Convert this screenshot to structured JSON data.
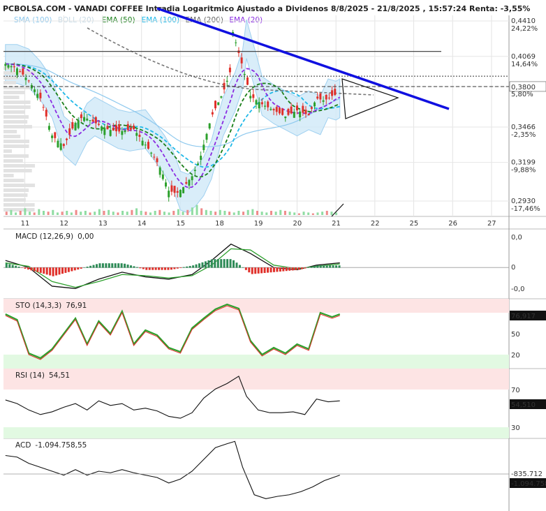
{
  "chart_data": [
    {
      "type": "candlestick",
      "title": "PCBOLSA.COM - VANADI COFFEE Intradia Logaritmico Ajustado a Dividenos 8/8/2025 - 21/8/2025 , 15:57:24 Renta: -3,55%",
      "legend": [
        {
          "label": "SMA (100)",
          "color": "#8ec9ee"
        },
        {
          "label": "BOLL (20)",
          "color": "#c8dbe6"
        },
        {
          "label": "EMA (50)",
          "color": "#1a7f1a"
        },
        {
          "label": "EMA (100)",
          "color": "#1fb8e8"
        },
        {
          "label": "EMA (200)",
          "color": "#666666"
        },
        {
          "label": "EMA (20)",
          "color": "#8a2be2"
        }
      ],
      "x_tick_labels": [
        "11",
        "12",
        "13",
        "14",
        "15",
        "18",
        "19",
        "20",
        "21",
        "22",
        "25",
        "26",
        "27"
      ],
      "y_tick_labels": [
        "0,4410",
        "0,4069",
        "0,3800",
        "0,3466",
        "0,3199",
        "0,2930"
      ],
      "y_pct_labels": [
        "24,22%",
        "14,64%",
        "5,80%",
        "-2,35%",
        "-9,88%",
        "-17,46%"
      ],
      "last_price": "0,3800",
      "ylim": [
        0.293,
        0.441
      ],
      "y_scale": "log",
      "close_path": [
        [
          0.0,
          0.4
        ],
        [
          0.3,
          0.396
        ],
        [
          0.6,
          0.385
        ],
        [
          0.9,
          0.37
        ],
        [
          1.2,
          0.34
        ],
        [
          1.5,
          0.332
        ],
        [
          1.8,
          0.35
        ],
        [
          2.0,
          0.355
        ],
        [
          2.3,
          0.35
        ],
        [
          2.6,
          0.345
        ],
        [
          2.9,
          0.343
        ],
        [
          3.3,
          0.345
        ],
        [
          3.6,
          0.333
        ],
        [
          3.8,
          0.325
        ],
        [
          4.0,
          0.315
        ],
        [
          4.2,
          0.3
        ],
        [
          4.4,
          0.298
        ],
        [
          4.6,
          0.303
        ],
        [
          4.8,
          0.31
        ],
        [
          5.0,
          0.322
        ],
        [
          5.3,
          0.355
        ],
        [
          5.6,
          0.375
        ],
        [
          5.8,
          0.395
        ],
        [
          5.85,
          0.43
        ],
        [
          6.0,
          0.41
        ],
        [
          6.3,
          0.372
        ],
        [
          6.6,
          0.365
        ],
        [
          6.9,
          0.36
        ],
        [
          7.2,
          0.355
        ],
        [
          7.5,
          0.36
        ],
        [
          7.8,
          0.356
        ],
        [
          8.0,
          0.37
        ],
        [
          8.2,
          0.368
        ],
        [
          8.4,
          0.372
        ],
        [
          8.6,
          0.374
        ]
      ],
      "volume": [
        4,
        6,
        3,
        5,
        8,
        4,
        3,
        7,
        5,
        4,
        6,
        3,
        4,
        5,
        3,
        6,
        4,
        5,
        3,
        4,
        7,
        5,
        6,
        4,
        3,
        5,
        4,
        6,
        8,
        5,
        4,
        3,
        5,
        6,
        4,
        3,
        5,
        7,
        4,
        6,
        9,
        12,
        8,
        6,
        5,
        4,
        6,
        5,
        4,
        3,
        5,
        4,
        6,
        7,
        5,
        4,
        3,
        5,
        4,
        6,
        5,
        4,
        3,
        2,
        4,
        3,
        2,
        3,
        4,
        5,
        4,
        3
      ]
    },
    {
      "type": "line",
      "name": "MACD",
      "label": "MACD (12,26,9)",
      "value": "0,00",
      "y_tick_labels": [
        "0,0",
        "0",
        "-0,0"
      ],
      "macd": [
        [
          0.0,
          0.3
        ],
        [
          0.6,
          0.0
        ],
        [
          1.2,
          -0.8
        ],
        [
          1.8,
          -0.9
        ],
        [
          2.4,
          -0.5
        ],
        [
          3.0,
          -0.2
        ],
        [
          3.6,
          -0.4
        ],
        [
          4.2,
          -0.5
        ],
        [
          4.8,
          -0.3
        ],
        [
          5.3,
          0.3
        ],
        [
          5.8,
          1.0
        ],
        [
          6.3,
          0.6
        ],
        [
          6.9,
          0.0
        ],
        [
          7.5,
          -0.1
        ],
        [
          8.0,
          0.1
        ],
        [
          8.6,
          0.2
        ]
      ],
      "signal": [
        [
          0.0,
          0.2
        ],
        [
          0.6,
          0.05
        ],
        [
          1.2,
          -0.6
        ],
        [
          1.8,
          -0.85
        ],
        [
          2.4,
          -0.6
        ],
        [
          3.0,
          -0.3
        ],
        [
          3.6,
          -0.35
        ],
        [
          4.2,
          -0.45
        ],
        [
          4.8,
          -0.35
        ],
        [
          5.3,
          0.1
        ],
        [
          5.8,
          0.8
        ],
        [
          6.3,
          0.75
        ],
        [
          6.9,
          0.1
        ],
        [
          7.5,
          -0.05
        ],
        [
          8.0,
          0.05
        ],
        [
          8.6,
          0.15
        ]
      ]
    },
    {
      "type": "line",
      "name": "STO",
      "label": "STO (14,3,3)",
      "value": "76,91",
      "last_value": "76,917",
      "y_tick_labels": [
        "50",
        "20"
      ],
      "bands": [
        80,
        20
      ],
      "values": [
        [
          0.0,
          78
        ],
        [
          0.3,
          70
        ],
        [
          0.6,
          22
        ],
        [
          0.9,
          15
        ],
        [
          1.2,
          28
        ],
        [
          1.5,
          50
        ],
        [
          1.8,
          72
        ],
        [
          2.1,
          35
        ],
        [
          2.4,
          68
        ],
        [
          2.7,
          50
        ],
        [
          3.0,
          82
        ],
        [
          3.3,
          35
        ],
        [
          3.6,
          55
        ],
        [
          3.9,
          48
        ],
        [
          4.2,
          30
        ],
        [
          4.5,
          24
        ],
        [
          4.8,
          58
        ],
        [
          5.1,
          72
        ],
        [
          5.4,
          85
        ],
        [
          5.7,
          92
        ],
        [
          6.0,
          86
        ],
        [
          6.3,
          40
        ],
        [
          6.6,
          20
        ],
        [
          6.9,
          30
        ],
        [
          7.2,
          22
        ],
        [
          7.5,
          35
        ],
        [
          7.8,
          28
        ],
        [
          8.1,
          80
        ],
        [
          8.4,
          74
        ],
        [
          8.6,
          78
        ]
      ]
    },
    {
      "type": "line",
      "name": "RSI",
      "label": "RSI (14)",
      "value": "54,51",
      "last_value": "54,510",
      "y_tick_labels": [
        "70",
        "30"
      ],
      "bands": [
        70,
        30
      ],
      "values": [
        [
          0.0,
          56
        ],
        [
          0.3,
          52
        ],
        [
          0.6,
          45
        ],
        [
          0.9,
          40
        ],
        [
          1.2,
          43
        ],
        [
          1.5,
          48
        ],
        [
          1.8,
          52
        ],
        [
          2.1,
          45
        ],
        [
          2.4,
          55
        ],
        [
          2.7,
          50
        ],
        [
          3.0,
          52
        ],
        [
          3.3,
          45
        ],
        [
          3.6,
          47
        ],
        [
          3.9,
          44
        ],
        [
          4.2,
          38
        ],
        [
          4.5,
          36
        ],
        [
          4.8,
          42
        ],
        [
          5.1,
          58
        ],
        [
          5.4,
          68
        ],
        [
          5.7,
          74
        ],
        [
          6.0,
          82
        ],
        [
          6.2,
          60
        ],
        [
          6.5,
          45
        ],
        [
          6.8,
          42
        ],
        [
          7.1,
          42
        ],
        [
          7.4,
          43
        ],
        [
          7.7,
          40
        ],
        [
          8.0,
          57
        ],
        [
          8.3,
          54
        ],
        [
          8.6,
          55
        ]
      ]
    },
    {
      "type": "line",
      "name": "ACD",
      "label": "ACD",
      "value": "-1.094.758,55",
      "y_tick_labels": [
        "-835.712",
        "-1.094.758"
      ],
      "values": [
        [
          0.0,
          0.2
        ],
        [
          0.3,
          0.22
        ],
        [
          0.6,
          0.3
        ],
        [
          0.9,
          0.35
        ],
        [
          1.2,
          0.4
        ],
        [
          1.5,
          0.45
        ],
        [
          1.8,
          0.38
        ],
        [
          2.1,
          0.45
        ],
        [
          2.4,
          0.4
        ],
        [
          2.7,
          0.42
        ],
        [
          3.0,
          0.38
        ],
        [
          3.3,
          0.42
        ],
        [
          3.6,
          0.45
        ],
        [
          3.9,
          0.48
        ],
        [
          4.2,
          0.55
        ],
        [
          4.5,
          0.5
        ],
        [
          4.8,
          0.4
        ],
        [
          5.1,
          0.25
        ],
        [
          5.4,
          0.1
        ],
        [
          5.7,
          0.05
        ],
        [
          5.9,
          0.02
        ],
        [
          6.1,
          0.35
        ],
        [
          6.4,
          0.7
        ],
        [
          6.7,
          0.75
        ],
        [
          7.0,
          0.72
        ],
        [
          7.3,
          0.7
        ],
        [
          7.6,
          0.66
        ],
        [
          7.9,
          0.6
        ],
        [
          8.2,
          0.52
        ],
        [
          8.6,
          0.45
        ]
      ]
    }
  ]
}
